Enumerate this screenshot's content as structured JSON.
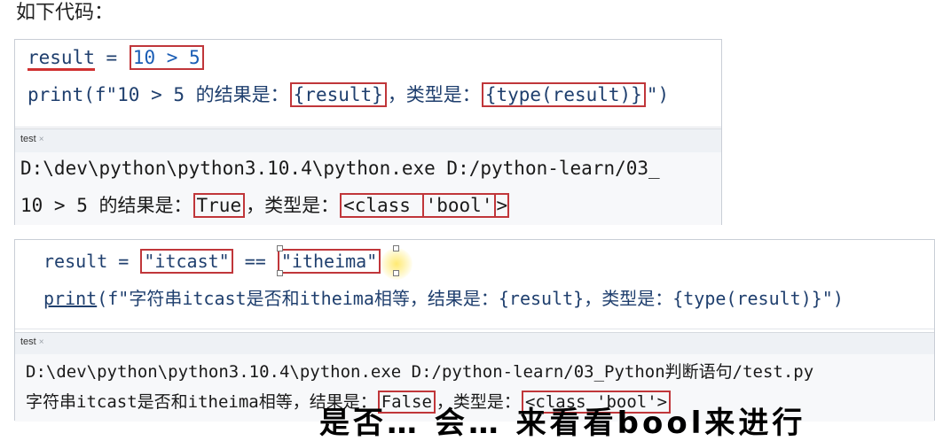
{
  "heading": "如下代码：",
  "panel1": {
    "code": {
      "line1": {
        "var": "result",
        "op": " = ",
        "expr": "10 > 5"
      },
      "line2": {
        "prefix": "print(f\"10 > 5 的结果是：",
        "part1": "{result}",
        "middle": "，类型是：",
        "part2": "{type(result)}",
        "suffix": "\")"
      }
    },
    "tab": {
      "label": "test",
      "close": "×"
    },
    "output": {
      "line1": "D:\\dev\\python\\python3.10.4\\python.exe D:/python-learn/03_",
      "line2": {
        "prefix": "10 > 5 的结果是：",
        "value": "True",
        "middle": "，类型是：",
        "type_open": "<class ",
        "type_name": "'bool'",
        "type_close": ">"
      }
    }
  },
  "panel2": {
    "code": {
      "line1": {
        "var": "result",
        "op": " = ",
        "left": "\"itcast\"",
        "cmp": " == ",
        "right": "\"itheima\""
      },
      "line2": {
        "func": "print",
        "text": "(f\"字符串itcast是否和itheima相等，结果是：{result}，类型是：{type(result)}\")"
      }
    },
    "tab": {
      "label": "test",
      "close": "×"
    },
    "output": {
      "line1": "D:\\dev\\python\\python3.10.4\\python.exe D:/python-learn/03_Python判断语句/test.py",
      "line2": {
        "prefix": "字符串itcast是否和itheima相等，结果是：",
        "value": "False",
        "middle": "，类型是：",
        "type": "<class 'bool'>"
      }
    }
  },
  "caption": "是否… 会… 来看看bool来进行"
}
